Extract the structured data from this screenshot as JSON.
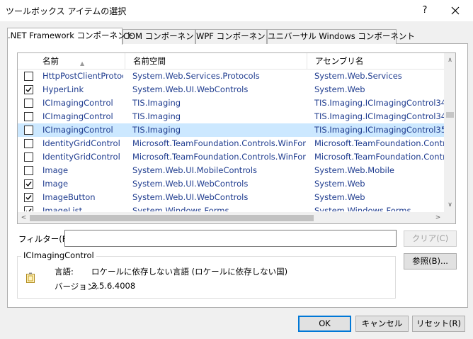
{
  "window": {
    "title": "ツールボックス アイテムの選択",
    "help_label": "?"
  },
  "tabs": [
    {
      "label": ".NET Framework コンポーネント"
    },
    {
      "label": "COM コンポーネント"
    },
    {
      "label": "WPF コンポーネント"
    },
    {
      "label": "ユニバーサル Windows コンポーネント"
    }
  ],
  "grid": {
    "columns": [
      "名前",
      "名前空間",
      "アセンブリ名"
    ],
    "rows": [
      {
        "name": "HttpPostClientProtocol",
        "namespace": "System.Web.Services.Protocols",
        "assembly": "System.Web.Services",
        "checked": false,
        "selected": false
      },
      {
        "name": "HyperLink",
        "namespace": "System.Web.UI.WebControls",
        "assembly": "System.Web",
        "checked": true,
        "selected": false
      },
      {
        "name": "ICImagingControl",
        "namespace": "TIS.Imaging",
        "assembly": "TIS.Imaging.ICImagingControl34",
        "checked": false,
        "selected": false
      },
      {
        "name": "ICImagingControl",
        "namespace": "TIS.Imaging",
        "assembly": "TIS.Imaging.ICImagingControl34",
        "checked": false,
        "selected": false
      },
      {
        "name": "ICImagingControl",
        "namespace": "TIS.Imaging",
        "assembly": "TIS.Imaging.ICImagingControl35",
        "checked": false,
        "selected": true
      },
      {
        "name": "IdentityGridControl",
        "namespace": "Microsoft.TeamFoundation.Controls.WinForms",
        "assembly": "Microsoft.TeamFoundation.Controls",
        "checked": false,
        "selected": false
      },
      {
        "name": "IdentityGridControl",
        "namespace": "Microsoft.TeamFoundation.Controls.WinForms",
        "assembly": "Microsoft.TeamFoundation.Controls",
        "checked": false,
        "selected": false
      },
      {
        "name": "Image",
        "namespace": "System.Web.UI.MobileControls",
        "assembly": "System.Web.Mobile",
        "checked": false,
        "selected": false
      },
      {
        "name": "Image",
        "namespace": "System.Web.UI.WebControls",
        "assembly": "System.Web",
        "checked": true,
        "selected": false
      },
      {
        "name": "ImageButton",
        "namespace": "System.Web.UI.WebControls",
        "assembly": "System.Web",
        "checked": true,
        "selected": false
      },
      {
        "name": "ImageList",
        "namespace": "System.Windows.Forms",
        "assembly": "System.Windows.Forms",
        "checked": true,
        "selected": false
      }
    ]
  },
  "filter": {
    "label": "フィルター(F):",
    "value": "",
    "clear_label": "クリア(C)"
  },
  "browse_label": "参照(B)...",
  "details": {
    "title": "ICImagingControl",
    "language_key": "言語:",
    "language_value": "ロケールに依存しない言語 (ロケールに依存しない国)",
    "version_key": "バージョン:",
    "version_value": "3.5.6.4008",
    "icon": "component-icon"
  },
  "buttons": {
    "ok": "OK",
    "cancel": "キャンセル",
    "reset": "リセット(R)"
  },
  "colors": {
    "selection": "#cce8ff",
    "link_text": "#1f3c8f",
    "default_border": "#0078d7"
  }
}
